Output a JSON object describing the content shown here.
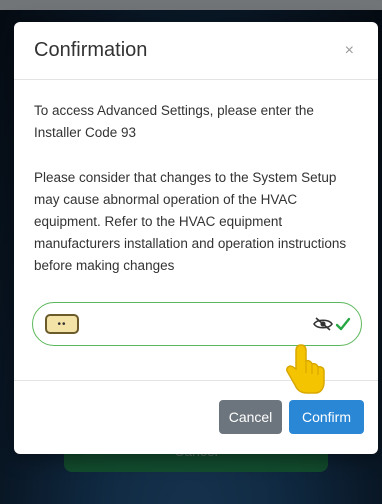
{
  "background": {
    "cancel_label": "Cancel"
  },
  "modal": {
    "title": "Confirmation",
    "close_symbol": "×",
    "paragraph1": "To access Advanced Settings, please enter the Installer Code 93",
    "paragraph2": "Please consider that changes to the System Setup may cause abnormal operation of the HVAC equipment. Refer to the HVAC equipment manufacturers installation and operation instructions before making changes",
    "code_field": {
      "masked_value": "••",
      "show_icon": "eye-slash-icon",
      "valid_icon": "checkmark-icon"
    },
    "buttons": {
      "cancel": "Cancel",
      "confirm": "Confirm"
    }
  },
  "colors": {
    "confirm": "#2a87d6",
    "cancel": "#6c757d",
    "valid_border": "#5cb85c",
    "pointer_hand": "#f5c400"
  }
}
